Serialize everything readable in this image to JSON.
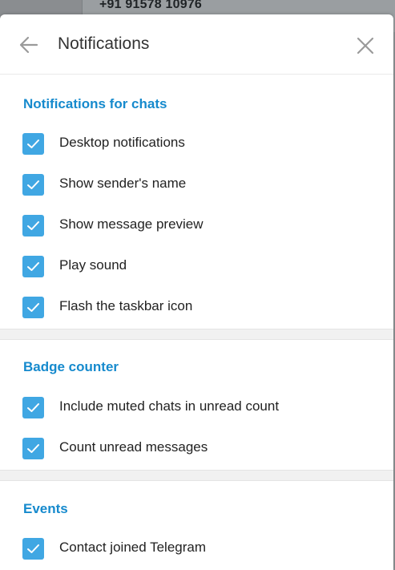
{
  "background": {
    "phone": "+91 91578 10976"
  },
  "header": {
    "title": "Notifications",
    "back_icon": "arrow-left-icon",
    "close_icon": "close-icon"
  },
  "sections": [
    {
      "title": "Notifications for chats",
      "items": [
        {
          "label": "Desktop notifications",
          "checked": true
        },
        {
          "label": "Show sender's name",
          "checked": true
        },
        {
          "label": "Show message preview",
          "checked": true
        },
        {
          "label": "Play sound",
          "checked": true
        },
        {
          "label": "Flash the taskbar icon",
          "checked": true
        }
      ]
    },
    {
      "title": "Badge counter",
      "items": [
        {
          "label": "Include muted chats in unread count",
          "checked": true
        },
        {
          "label": "Count unread messages",
          "checked": true
        }
      ]
    },
    {
      "title": "Events",
      "items": [
        {
          "label": "Contact joined Telegram",
          "checked": true
        }
      ]
    }
  ],
  "colors": {
    "accent": "#40a7e3",
    "section_title": "#168acd"
  }
}
